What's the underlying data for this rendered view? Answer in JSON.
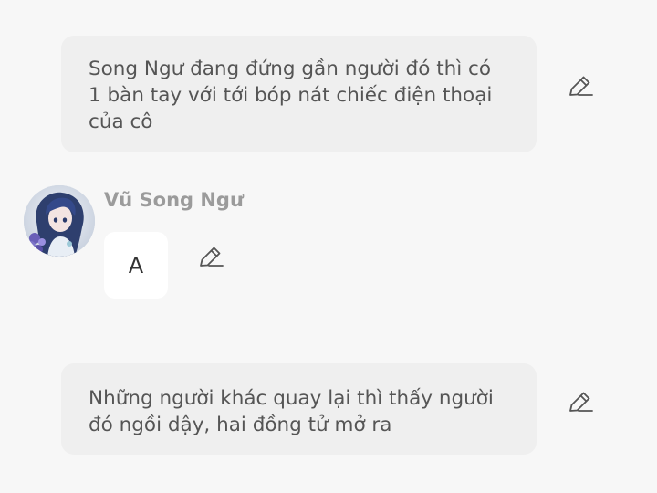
{
  "story": {
    "narration_1": "Song Ngư đang đứng gần người đó thì có 1 bàn tay với tới bóp nát chiếc điện thoại của cô",
    "character": {
      "name": "Vũ Song Ngư",
      "avatar": "anime-girl-avatar",
      "message": "A"
    },
    "narration_2": "Những người khác quay lại thì thấy người đó ngồi dậy, hai đồng tử mở ra"
  },
  "icons": {
    "edit": "pencil-icon"
  },
  "colors": {
    "background": "#f7f7f7",
    "narration_bubble": "#efefef",
    "dialog_bubble": "#ffffff",
    "narration_text": "#555555",
    "name_text": "#9b9b9b",
    "icon": "#555555"
  }
}
